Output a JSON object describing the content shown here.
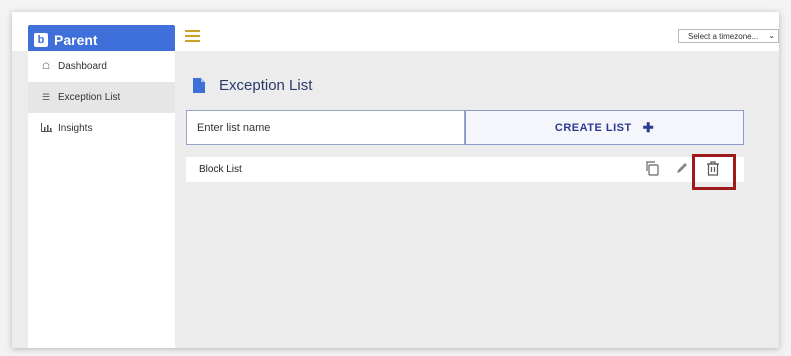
{
  "brand": {
    "logo_letter": "b",
    "name": "Parent"
  },
  "header": {
    "timezone_select": "Select a timezone..."
  },
  "sidebar": {
    "items": [
      {
        "label": "Dashboard",
        "icon": "home-icon"
      },
      {
        "label": "Exception List",
        "icon": "list-icon",
        "active": true
      },
      {
        "label": "Insights",
        "icon": "bar-chart-icon"
      }
    ]
  },
  "main": {
    "title": "Exception List",
    "list_name_input": {
      "value": "Enter list name"
    },
    "create_button": "CREATE LIST",
    "lists": [
      {
        "name": "Block List"
      }
    ]
  },
  "colors": {
    "brand": "#3f6fd8",
    "hamburger": "#c9a227",
    "title": "#2b3a6b",
    "highlight": "#9e1b1b"
  }
}
